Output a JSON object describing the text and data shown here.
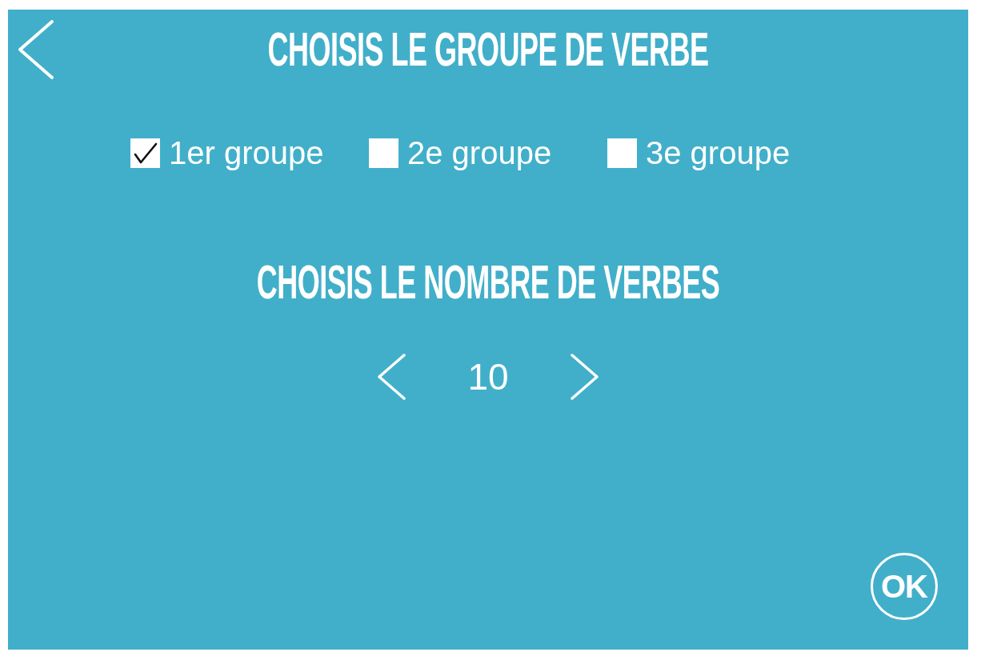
{
  "header": {
    "title": "CHOISIS LE GROUPE DE VERBE"
  },
  "verb_groups": [
    {
      "label": "1er groupe",
      "checked": true
    },
    {
      "label": "2e groupe",
      "checked": false
    },
    {
      "label": "3e groupe",
      "checked": false
    }
  ],
  "count_section": {
    "title": "CHOISIS LE NOMBRE DE VERBES",
    "value": "10"
  },
  "ok_button": {
    "label": "OK"
  }
}
